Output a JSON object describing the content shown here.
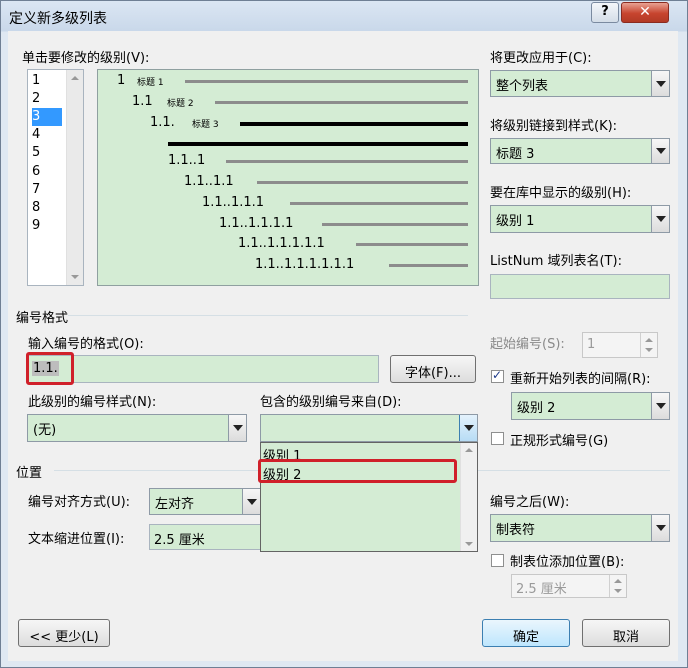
{
  "window": {
    "title": "定义新多级列表",
    "help": "?",
    "close": "✕"
  },
  "levels_section": {
    "label": "单击要修改的级别(V):",
    "levels": [
      "1",
      "2",
      "3",
      "4",
      "5",
      "6",
      "7",
      "8",
      "9"
    ],
    "selected_index": 2
  },
  "preview": {
    "rows": [
      {
        "num": "1",
        "heading": "标题 1"
      },
      {
        "num": "1.1",
        "heading": "标题 2"
      },
      {
        "num": "1.1.",
        "heading": "标题 3"
      },
      {
        "num": "",
        "heading": ""
      },
      {
        "num": "1.1..1",
        "heading": ""
      },
      {
        "num": "1.1..1.1",
        "heading": ""
      },
      {
        "num": "1.1..1.1.1",
        "heading": ""
      },
      {
        "num": "1.1..1.1.1.1",
        "heading": ""
      },
      {
        "num": "1.1..1.1.1.1.1",
        "heading": ""
      },
      {
        "num": "1.1..1.1.1.1.1.1",
        "heading": ""
      }
    ]
  },
  "apply_to": {
    "label": "将更改应用于(C):",
    "value": "整个列表"
  },
  "link_style": {
    "label": "将级别链接到样式(K):",
    "value": "标题 3"
  },
  "gallery_level": {
    "label": "要在库中显示的级别(H):",
    "value": "级别 1"
  },
  "listnum": {
    "label": "ListNum 域列表名(T):",
    "value": ""
  },
  "number_format": {
    "section": "编号格式",
    "format_label": "输入编号的格式(O):",
    "format_value": "1.1.",
    "font_button": "字体(F)...",
    "style_label": "此级别的编号样式(N):",
    "style_value": "(无)",
    "include_label": "包含的级别编号来自(D):",
    "include_value": "",
    "include_options": [
      "级别 1",
      "级别 2"
    ]
  },
  "start_at": {
    "label": "起始编号(S):",
    "value": "1"
  },
  "restart": {
    "label": "重新开始列表的间隔(R):",
    "checked": true,
    "value": "级别 2"
  },
  "legal": {
    "label": "正规形式编号(G)",
    "checked": false
  },
  "position": {
    "section": "位置",
    "align_label": "编号对齐方式(U):",
    "align_value": "左对齐",
    "indent_label": "文本缩进位置(I):",
    "indent_value": "2.5 厘米"
  },
  "follow": {
    "label": "编号之后(W):",
    "value": "制表符"
  },
  "tab_add": {
    "label": "制表位添加位置(B):",
    "checked": false,
    "value": "2.5 厘米"
  },
  "buttons": {
    "less": "<< 更少(L)",
    "ok": "确定",
    "cancel": "取消"
  }
}
